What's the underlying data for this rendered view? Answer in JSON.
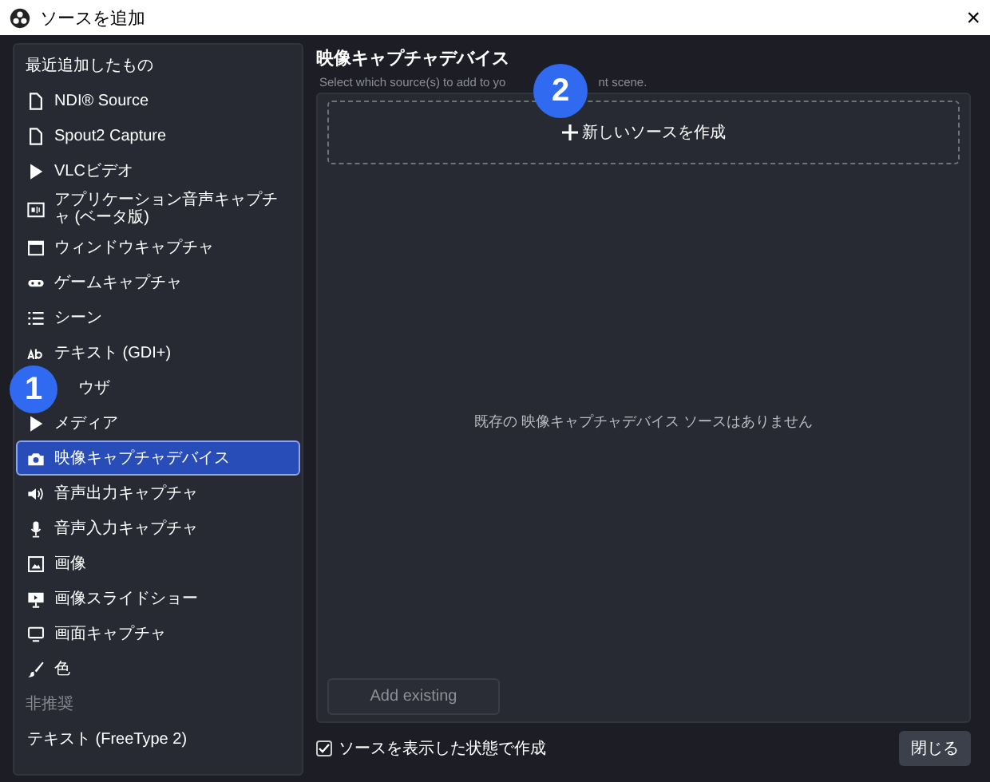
{
  "window": {
    "title": "ソースを追加",
    "close": "×"
  },
  "sources": [
    {
      "kind": "header",
      "label": "最近追加したもの",
      "disabled": false
    },
    {
      "kind": "file",
      "label": "NDI® Source",
      "selected": false
    },
    {
      "kind": "file",
      "label": "Spout2 Capture",
      "selected": false
    },
    {
      "kind": "play",
      "label": "VLCビデオ",
      "selected": false
    },
    {
      "kind": "app-audio",
      "label": "アプリケーション音声キャプチャ (ベータ版)",
      "selected": false
    },
    {
      "kind": "window",
      "label": "ウィンドウキャプチャ",
      "selected": false
    },
    {
      "kind": "gamepad",
      "label": "ゲームキャプチャ",
      "selected": false
    },
    {
      "kind": "list",
      "label": "シーン",
      "selected": false
    },
    {
      "kind": "text",
      "label": "テキスト (GDI+)",
      "selected": false
    },
    {
      "kind": "covered",
      "label": "ウザ",
      "selected": false
    },
    {
      "kind": "play",
      "label": "メディア",
      "selected": false
    },
    {
      "kind": "camera",
      "label": "映像キャプチャデバイス",
      "selected": true
    },
    {
      "kind": "speaker",
      "label": "音声出力キャプチャ",
      "selected": false
    },
    {
      "kind": "mic",
      "label": "音声入力キャプチャ",
      "selected": false
    },
    {
      "kind": "image",
      "label": "画像",
      "selected": false
    },
    {
      "kind": "slideshow",
      "label": "画像スライドショー",
      "selected": false
    },
    {
      "kind": "monitor",
      "label": "画面キャプチャ",
      "selected": false
    },
    {
      "kind": "brush",
      "label": "色",
      "selected": false
    },
    {
      "kind": "header",
      "label": "非推奨",
      "disabled": true
    },
    {
      "kind": "plain",
      "label": "テキスト (FreeType 2)",
      "selected": false
    }
  ],
  "panel": {
    "title": "映像キャプチャデバイス",
    "subtitle_parts": [
      "Select which source(s) to add to yo",
      "nt scene."
    ],
    "create_new": "新しいソースを作成",
    "empty_message": "既存の 映像キャプチャデバイス ソースはありません",
    "add_existing": {
      "label": "Add existing",
      "disabled": true
    }
  },
  "footer": {
    "visible_checkbox": {
      "label": "ソースを表示した状態で作成",
      "checked": true
    },
    "close_button": "閉じる"
  },
  "callouts": [
    "1",
    "2"
  ]
}
